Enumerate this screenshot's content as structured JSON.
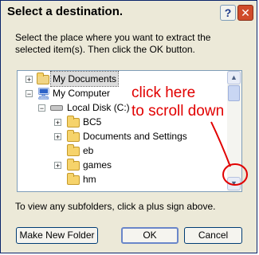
{
  "window": {
    "title": "Select a destination.",
    "help_label": "?",
    "close_label": "✕"
  },
  "instruction": "Select the place where you want to extract the selected item(s).  Then click the OK button.",
  "tree": {
    "items": [
      {
        "label": "My Documents",
        "expander": "+"
      },
      {
        "label": "My Computer",
        "expander": "−"
      },
      {
        "label": "Local Disk (C:)",
        "expander": "−"
      },
      {
        "label": "BC5",
        "expander": "+"
      },
      {
        "label": "Documents and Settings",
        "expander": "+"
      },
      {
        "label": "eb",
        "expander": ""
      },
      {
        "label": "games",
        "expander": "+"
      },
      {
        "label": "hm",
        "expander": ""
      }
    ],
    "scroll_up": "▲",
    "scroll_down": "▼"
  },
  "annotation": {
    "line1": "click here",
    "line2": "to scroll down",
    "color": "#e10000"
  },
  "hint": "To view any subfolders, click a plus sign above.",
  "buttons": {
    "make_folder": "Make New Folder",
    "ok": "OK",
    "cancel": "Cancel"
  }
}
